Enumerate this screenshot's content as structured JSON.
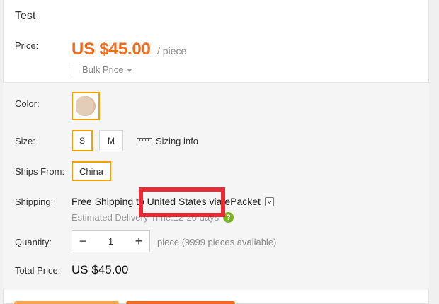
{
  "product": {
    "title": "Test",
    "price_label": "Price:",
    "price": "US $45.00",
    "unit": "/ piece",
    "bulk_price": "Bulk Price"
  },
  "sku": {
    "color_label": "Color:",
    "size_label": "Size:",
    "sizes": [
      {
        "label": "S",
        "selected": true
      },
      {
        "label": "M",
        "selected": false
      }
    ],
    "sizing_info": "Sizing info",
    "ships_from_label": "Ships From:",
    "ships_from": "China"
  },
  "shipping": {
    "label": "Shipping:",
    "text": "Free Shipping to United States via ePacket",
    "delivery": "Estimated Delivery Time:12-20 days",
    "help_icon": "?"
  },
  "quantity": {
    "label": "Quantity:",
    "minus": "−",
    "value": "1",
    "plus": "+",
    "available": "piece (9999 pieces available)"
  },
  "total": {
    "label": "Total Price:",
    "value": "US $45.00"
  },
  "colors": {
    "accent_orange": "#f36c1a",
    "selected_border": "#f2a200",
    "highlight_red": "#ea2b36",
    "help_green": "#7ab51d"
  }
}
